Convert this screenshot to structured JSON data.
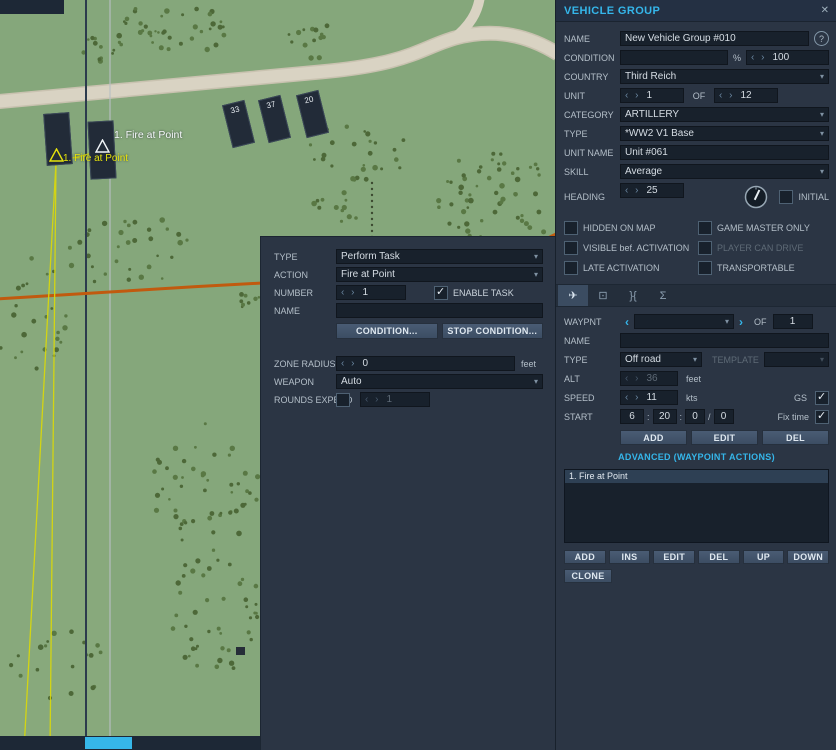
{
  "colors": {
    "accent_cyan": "#35b6ea",
    "panel_bg": "#2b3544",
    "field_bg": "#18212c",
    "map_green": "#85a77b",
    "route_yellow": "#dcd908",
    "road_orange": "#c15a0f"
  },
  "map": {
    "unit_numbers": [
      "33",
      "37",
      "20"
    ],
    "waypoint_label": "1. Fire at Point",
    "selected_route_label": "1. Fire at Point"
  },
  "vehicle_group": {
    "title": "VEHICLE GROUP",
    "close_icon": "✕",
    "help_icon": "?",
    "name_label": "NAME",
    "name_value": "New Vehicle Group #010",
    "condition_label": "CONDITION",
    "condition_value": "",
    "percent_label": "%",
    "condition_max": "100",
    "country_label": "COUNTRY",
    "country_value": "Third Reich",
    "unit_label": "UNIT",
    "unit_index": "1",
    "of_label": "OF",
    "unit_count": "12",
    "category_label": "CATEGORY",
    "category_value": "ARTILLERY",
    "type_label": "TYPE",
    "type_value": "*WW2 V1 Base",
    "unit_name_label": "UNIT NAME",
    "unit_name_value": "Unit #061",
    "skill_label": "SKILL",
    "skill_value": "Average",
    "heading_label": "HEADING",
    "heading_value": "25",
    "initial_label": "INITIAL",
    "checkboxes": [
      {
        "label": "HIDDEN ON MAP"
      },
      {
        "label": "GAME MASTER ONLY"
      },
      {
        "label": "VISIBLE bef. ACTIVATION"
      },
      {
        "label": "PLAYER CAN DRIVE"
      },
      {
        "label": "LATE ACTIVATION"
      },
      {
        "label": "TRANSPORTABLE"
      }
    ],
    "tab_icons": [
      "✈",
      "⊡",
      "}{",
      "Σ"
    ]
  },
  "waypoint": {
    "waypnt_label": "WAYPNT",
    "prev_arrow": "‹",
    "next_arrow": "›",
    "waypnt_value": "",
    "of_label": "OF",
    "waypnt_total": "1",
    "name_label": "NAME",
    "name_value": "",
    "type_label": "TYPE",
    "type_value": "Off road",
    "template_label": "TEMPLATE",
    "template_value": "",
    "alt_label": "ALT",
    "alt_value": "36",
    "alt_unit": "feet",
    "speed_label": "SPEED",
    "speed_value": "11",
    "speed_unit": "kts",
    "gs_label": "GS",
    "start_label": "START",
    "start_h": "6",
    "start_m": "20",
    "start_s": "0",
    "start_day": "0",
    "colon": ":",
    "slash": "/",
    "fix_time_label": "Fix time",
    "add_button": "ADD",
    "edit_button": "EDIT",
    "del_button": "DEL",
    "advanced_link": "ADVANCED (WAYPOINT ACTIONS)",
    "actions": [
      "1. Fire at Point"
    ],
    "list_buttons": [
      "ADD",
      "INS",
      "EDIT",
      "DEL",
      "UP",
      "DOWN"
    ],
    "clone_button": "CLONE"
  },
  "task": {
    "type_label": "TYPE",
    "type_value": "Perform Task",
    "action_label": "ACTION",
    "action_value": "Fire at Point",
    "number_label": "NUMBER",
    "number_value": "1",
    "enable_task_label": "ENABLE TASK",
    "name_label": "NAME",
    "name_value": "",
    "condition_button": "CONDITION...",
    "stop_condition_button": "STOP CONDITION...",
    "zone_radius_label": "ZONE RADIUS",
    "zone_radius_value": "0",
    "zone_radius_unit": "feet",
    "weapon_label": "WEAPON",
    "weapon_value": "Auto",
    "rounds_label": "ROUNDS EXPEND",
    "rounds_value": "1"
  }
}
